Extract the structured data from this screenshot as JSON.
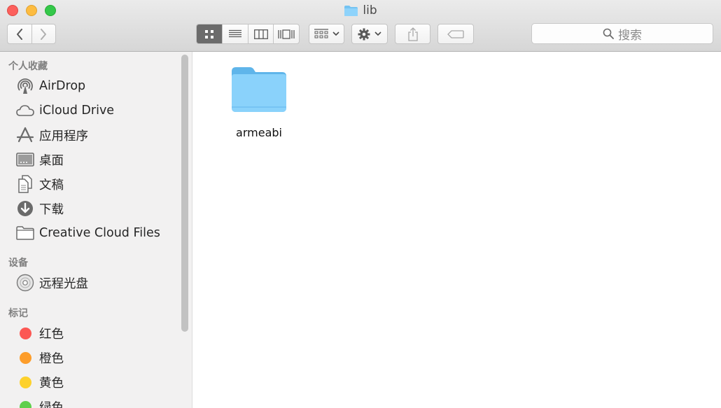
{
  "window": {
    "title": "lib"
  },
  "search": {
    "label": "搜索"
  },
  "sidebar": {
    "sections": [
      {
        "title": "个人收藏",
        "items": [
          {
            "label": "AirDrop",
            "icon": "airdrop-icon"
          },
          {
            "label": "iCloud Drive",
            "icon": "icloud-icon"
          },
          {
            "label": "应用程序",
            "icon": "applications-icon"
          },
          {
            "label": "桌面",
            "icon": "desktop-icon"
          },
          {
            "label": "文稿",
            "icon": "documents-icon"
          },
          {
            "label": "下载",
            "icon": "downloads-icon"
          },
          {
            "label": "Creative Cloud Files",
            "icon": "folder-icon"
          }
        ]
      },
      {
        "title": "设备",
        "items": [
          {
            "label": "远程光盘",
            "icon": "disc-icon"
          }
        ]
      },
      {
        "title": "标记",
        "items": [
          {
            "label": "红色",
            "color": "#fc5753"
          },
          {
            "label": "橙色",
            "color": "#fd9d2a"
          },
          {
            "label": "黄色",
            "color": "#fdd12c"
          },
          {
            "label": "绿色",
            "color": "#5fcf4c"
          }
        ]
      }
    ]
  },
  "files": [
    {
      "name": "armeabi",
      "icon": "folder-icon"
    }
  ],
  "colors": {
    "folder": "#72c4f4",
    "folder_tab": "#5aa9e0",
    "accent": "#6b6b6b"
  }
}
